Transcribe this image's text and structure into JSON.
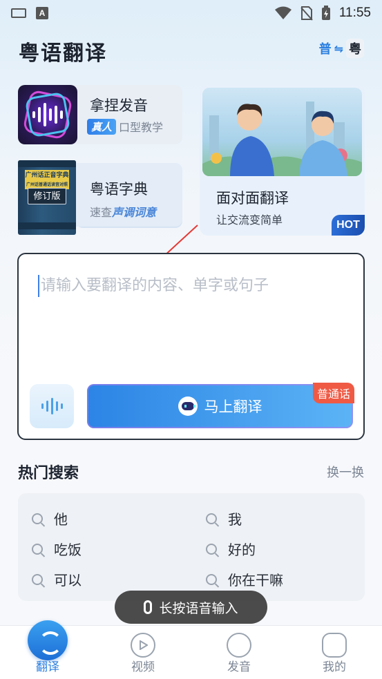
{
  "status_bar": {
    "time": "11:55",
    "left_badge": "A"
  },
  "header": {
    "title": "粤语翻译",
    "lang_from": "普",
    "lang_swap_icon": "swap-arrows-icon",
    "lang_to": "粤"
  },
  "cards": {
    "pronunciation": {
      "title": "拿捏发音",
      "tag": "真人",
      "subtitle": "口型教学"
    },
    "dictionary": {
      "title": "粤语字典",
      "subtitle_prefix": "速查",
      "subtitle_emph": "声调词意",
      "book_title": "广州话正音字典",
      "book_sub": "广州话普通话读音对照",
      "book_label": "修订版"
    },
    "face_to_face": {
      "title": "面对面翻译",
      "subtitle": "让交流变简单",
      "badge": "HOT"
    }
  },
  "input": {
    "placeholder": "请输入要翻译的内容、单字或句子",
    "translate_label": "马上翻译",
    "mode_badge": "普通话"
  },
  "hot_search": {
    "title": "热门搜索",
    "refresh_label": "换一换",
    "items": [
      "他",
      "我",
      "吃饭",
      "好的",
      "可以",
      "你在干嘛"
    ]
  },
  "toast": {
    "label": "长按语音输入"
  },
  "nav": {
    "items": [
      {
        "label": "翻译",
        "active": true
      },
      {
        "label": "视频",
        "active": false
      },
      {
        "label": "发音",
        "active": false
      },
      {
        "label": "我的",
        "active": false
      }
    ]
  },
  "colors": {
    "accent": "#2a7fe0",
    "hot_badge": "#1b4fae",
    "mode_badge": "#ef5a45"
  }
}
